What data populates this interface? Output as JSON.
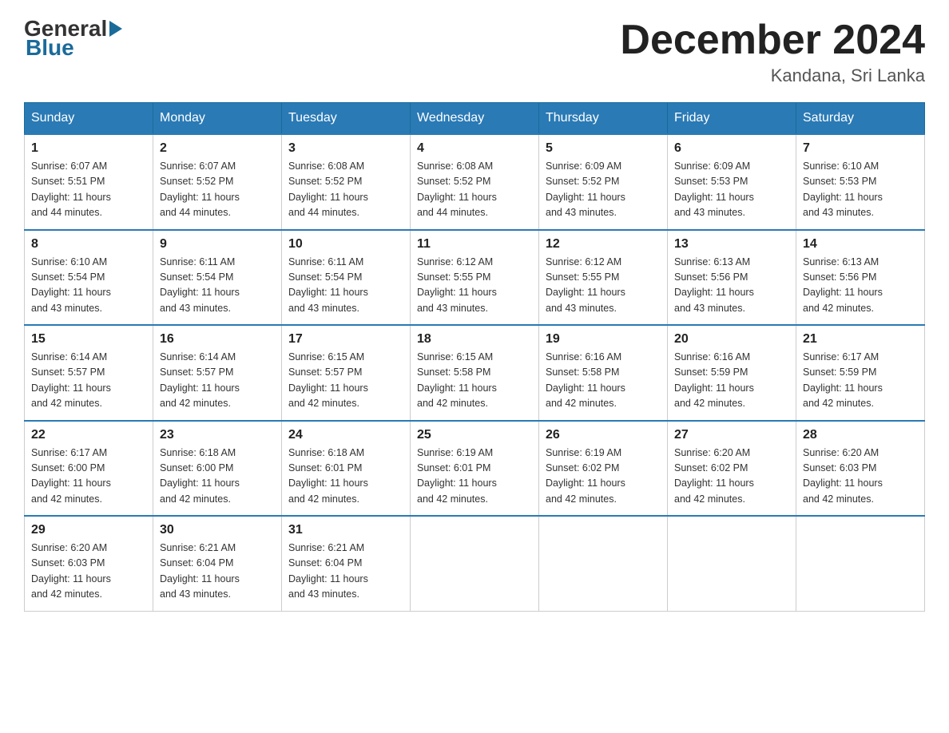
{
  "header": {
    "logo_general": "General",
    "logo_blue": "Blue",
    "month_title": "December 2024",
    "location": "Kandana, Sri Lanka"
  },
  "days_of_week": [
    "Sunday",
    "Monday",
    "Tuesday",
    "Wednesday",
    "Thursday",
    "Friday",
    "Saturday"
  ],
  "weeks": [
    [
      {
        "day": "1",
        "sunrise": "6:07 AM",
        "sunset": "5:51 PM",
        "daylight": "11 hours and 44 minutes."
      },
      {
        "day": "2",
        "sunrise": "6:07 AM",
        "sunset": "5:52 PM",
        "daylight": "11 hours and 44 minutes."
      },
      {
        "day": "3",
        "sunrise": "6:08 AM",
        "sunset": "5:52 PM",
        "daylight": "11 hours and 44 minutes."
      },
      {
        "day": "4",
        "sunrise": "6:08 AM",
        "sunset": "5:52 PM",
        "daylight": "11 hours and 44 minutes."
      },
      {
        "day": "5",
        "sunrise": "6:09 AM",
        "sunset": "5:52 PM",
        "daylight": "11 hours and 43 minutes."
      },
      {
        "day": "6",
        "sunrise": "6:09 AM",
        "sunset": "5:53 PM",
        "daylight": "11 hours and 43 minutes."
      },
      {
        "day": "7",
        "sunrise": "6:10 AM",
        "sunset": "5:53 PM",
        "daylight": "11 hours and 43 minutes."
      }
    ],
    [
      {
        "day": "8",
        "sunrise": "6:10 AM",
        "sunset": "5:54 PM",
        "daylight": "11 hours and 43 minutes."
      },
      {
        "day": "9",
        "sunrise": "6:11 AM",
        "sunset": "5:54 PM",
        "daylight": "11 hours and 43 minutes."
      },
      {
        "day": "10",
        "sunrise": "6:11 AM",
        "sunset": "5:54 PM",
        "daylight": "11 hours and 43 minutes."
      },
      {
        "day": "11",
        "sunrise": "6:12 AM",
        "sunset": "5:55 PM",
        "daylight": "11 hours and 43 minutes."
      },
      {
        "day": "12",
        "sunrise": "6:12 AM",
        "sunset": "5:55 PM",
        "daylight": "11 hours and 43 minutes."
      },
      {
        "day": "13",
        "sunrise": "6:13 AM",
        "sunset": "5:56 PM",
        "daylight": "11 hours and 43 minutes."
      },
      {
        "day": "14",
        "sunrise": "6:13 AM",
        "sunset": "5:56 PM",
        "daylight": "11 hours and 42 minutes."
      }
    ],
    [
      {
        "day": "15",
        "sunrise": "6:14 AM",
        "sunset": "5:57 PM",
        "daylight": "11 hours and 42 minutes."
      },
      {
        "day": "16",
        "sunrise": "6:14 AM",
        "sunset": "5:57 PM",
        "daylight": "11 hours and 42 minutes."
      },
      {
        "day": "17",
        "sunrise": "6:15 AM",
        "sunset": "5:57 PM",
        "daylight": "11 hours and 42 minutes."
      },
      {
        "day": "18",
        "sunrise": "6:15 AM",
        "sunset": "5:58 PM",
        "daylight": "11 hours and 42 minutes."
      },
      {
        "day": "19",
        "sunrise": "6:16 AM",
        "sunset": "5:58 PM",
        "daylight": "11 hours and 42 minutes."
      },
      {
        "day": "20",
        "sunrise": "6:16 AM",
        "sunset": "5:59 PM",
        "daylight": "11 hours and 42 minutes."
      },
      {
        "day": "21",
        "sunrise": "6:17 AM",
        "sunset": "5:59 PM",
        "daylight": "11 hours and 42 minutes."
      }
    ],
    [
      {
        "day": "22",
        "sunrise": "6:17 AM",
        "sunset": "6:00 PM",
        "daylight": "11 hours and 42 minutes."
      },
      {
        "day": "23",
        "sunrise": "6:18 AM",
        "sunset": "6:00 PM",
        "daylight": "11 hours and 42 minutes."
      },
      {
        "day": "24",
        "sunrise": "6:18 AM",
        "sunset": "6:01 PM",
        "daylight": "11 hours and 42 minutes."
      },
      {
        "day": "25",
        "sunrise": "6:19 AM",
        "sunset": "6:01 PM",
        "daylight": "11 hours and 42 minutes."
      },
      {
        "day": "26",
        "sunrise": "6:19 AM",
        "sunset": "6:02 PM",
        "daylight": "11 hours and 42 minutes."
      },
      {
        "day": "27",
        "sunrise": "6:20 AM",
        "sunset": "6:02 PM",
        "daylight": "11 hours and 42 minutes."
      },
      {
        "day": "28",
        "sunrise": "6:20 AM",
        "sunset": "6:03 PM",
        "daylight": "11 hours and 42 minutes."
      }
    ],
    [
      {
        "day": "29",
        "sunrise": "6:20 AM",
        "sunset": "6:03 PM",
        "daylight": "11 hours and 42 minutes."
      },
      {
        "day": "30",
        "sunrise": "6:21 AM",
        "sunset": "6:04 PM",
        "daylight": "11 hours and 43 minutes."
      },
      {
        "day": "31",
        "sunrise": "6:21 AM",
        "sunset": "6:04 PM",
        "daylight": "11 hours and 43 minutes."
      },
      null,
      null,
      null,
      null
    ]
  ],
  "labels": {
    "sunrise": "Sunrise:",
    "sunset": "Sunset:",
    "daylight": "Daylight:"
  }
}
